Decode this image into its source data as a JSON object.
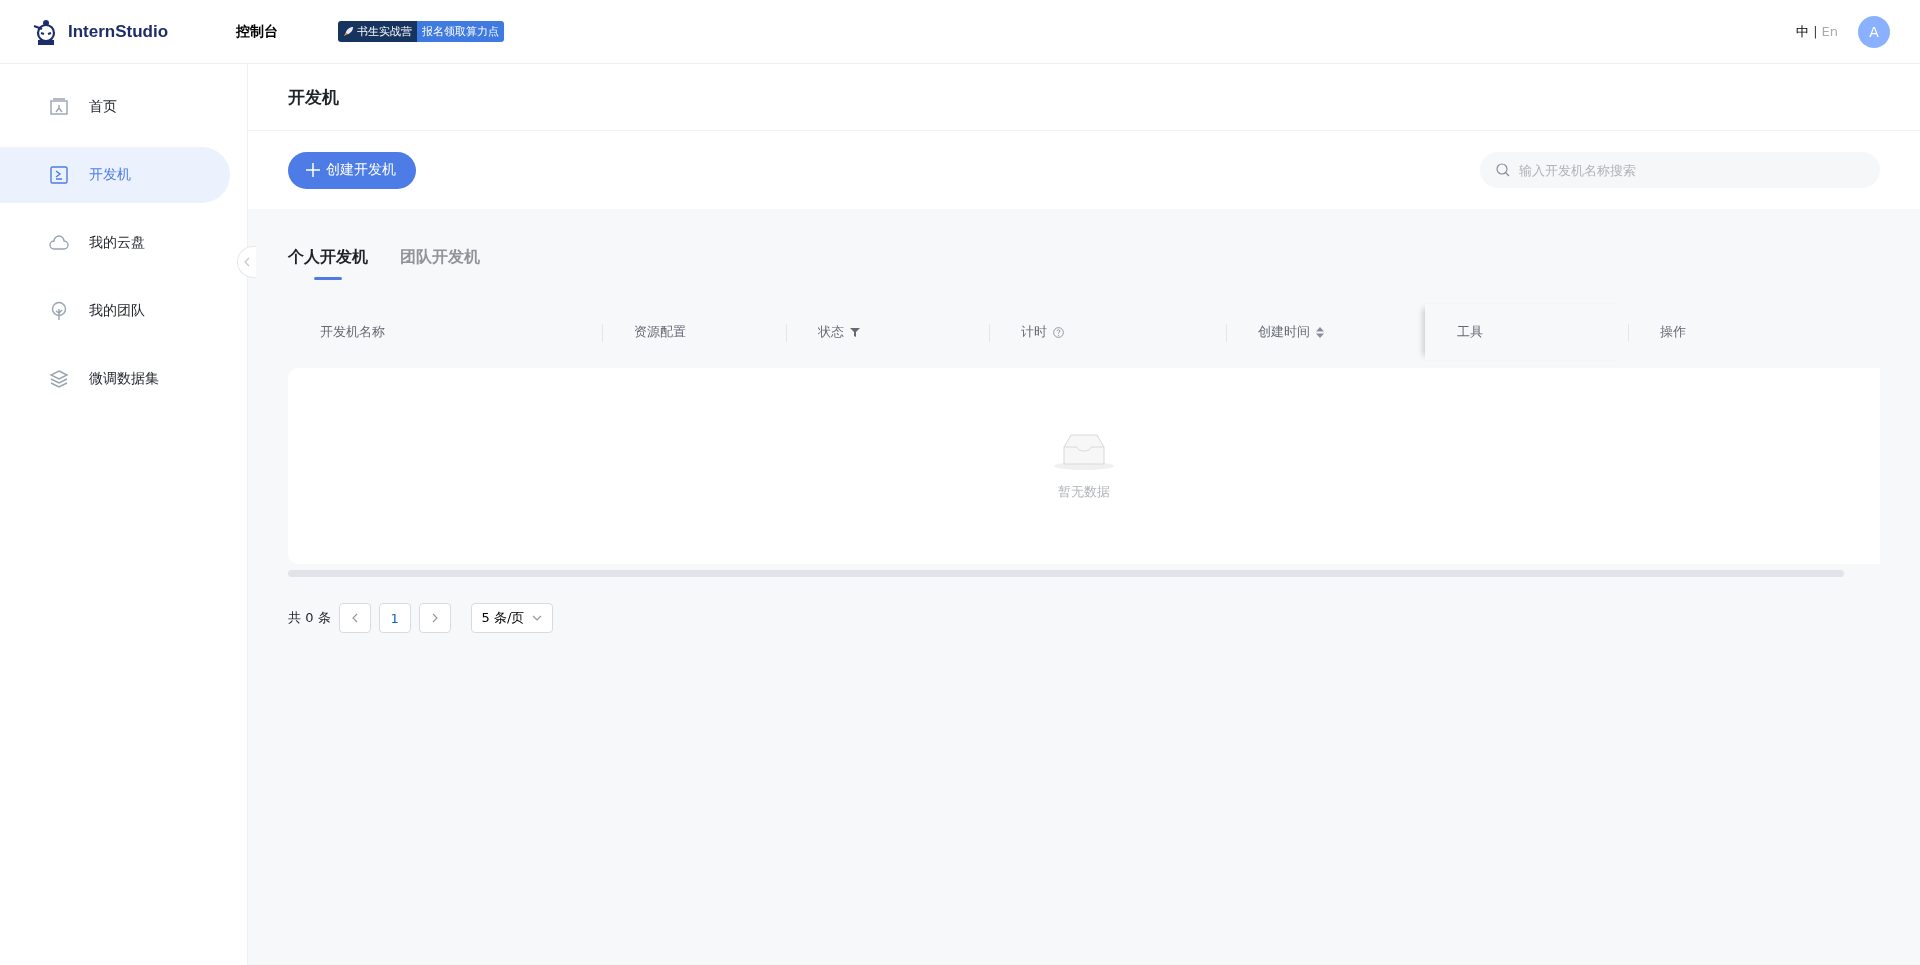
{
  "header": {
    "logo_text": "InternStudio",
    "nav": "控制台",
    "banner": {
      "left": "书生实战营",
      "right": "报名领取算力点"
    },
    "languages": [
      {
        "label": "中",
        "selected": true
      },
      {
        "label": "En",
        "selected": false
      }
    ],
    "separator": "|",
    "avatar": "A"
  },
  "sidebar": {
    "items": [
      {
        "label": "首页",
        "selected": false
      },
      {
        "label": "开发机",
        "selected": true
      },
      {
        "label": "我的云盘",
        "selected": false
      },
      {
        "label": "我的团队",
        "selected": false
      },
      {
        "label": "微调数据集",
        "selected": false
      }
    ]
  },
  "page_title": "开发机",
  "create_button": "创建开发机",
  "search": {
    "placeholder": "输入开发机名称搜索"
  },
  "tabs": [
    {
      "label": "个人开发机",
      "selected": true
    },
    {
      "label": "团队开发机",
      "selected": false
    }
  ],
  "table": {
    "columns": [
      {
        "label": "开发机名称",
        "kind": "plain"
      },
      {
        "label": "资源配置",
        "kind": "plain"
      },
      {
        "label": "状态",
        "kind": "filter"
      },
      {
        "label": "计时",
        "kind": "help"
      },
      {
        "label": "创建时间",
        "kind": "sort"
      },
      {
        "label": "工具",
        "kind": "plain"
      },
      {
        "label": "操作",
        "kind": "plain"
      }
    ],
    "empty_text": "暂无数据"
  },
  "pagination": {
    "total": "共 0 条",
    "pages": [
      {
        "label": "1",
        "selected": true
      }
    ],
    "page_size": "5 条/页"
  }
}
